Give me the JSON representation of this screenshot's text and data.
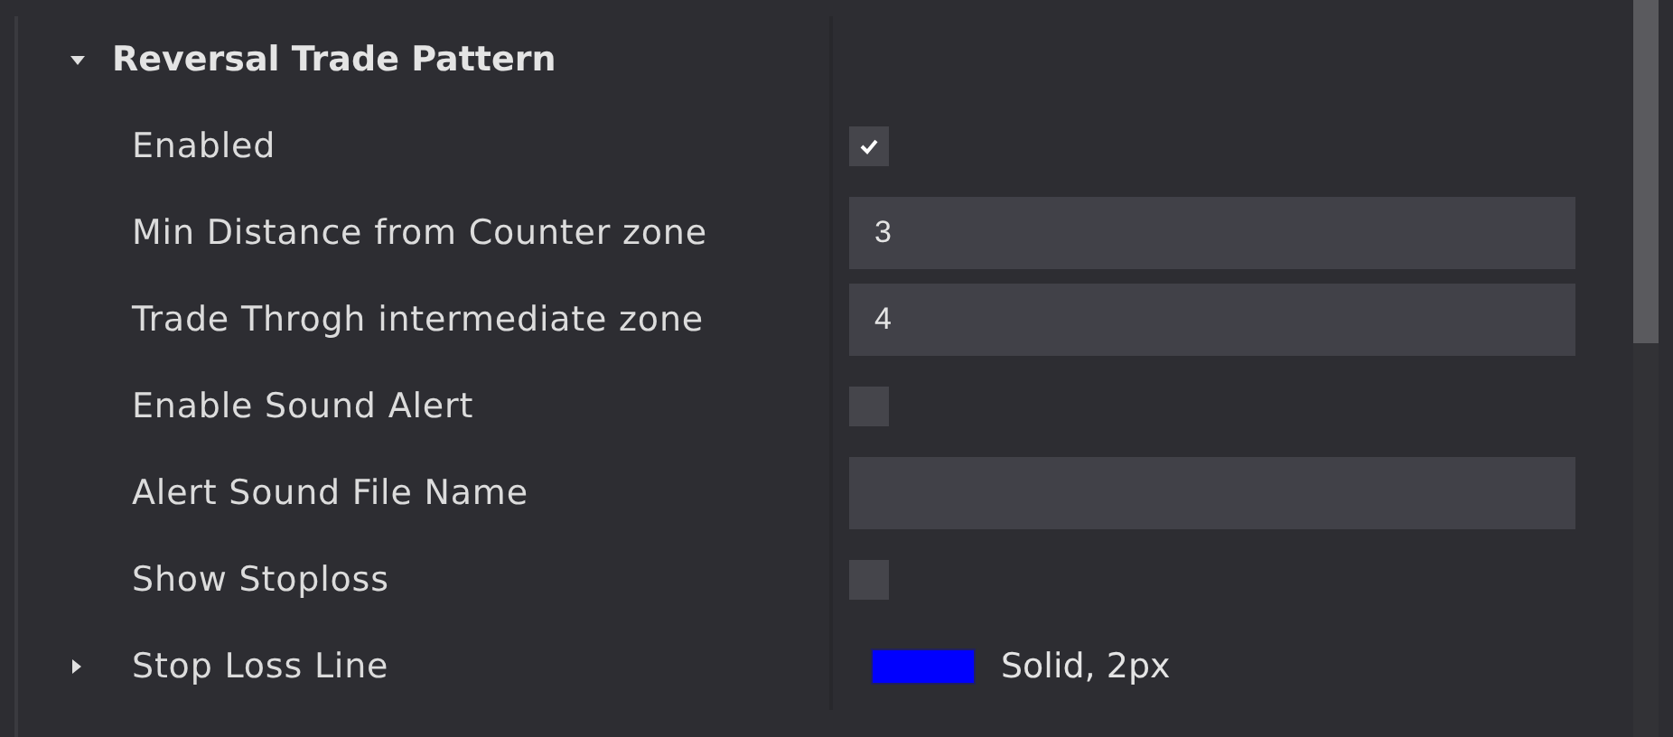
{
  "category": {
    "title": "Reversal Trade Pattern",
    "expanded": true
  },
  "properties": [
    {
      "label": "Enabled",
      "kind": "checkbox",
      "checked": true
    },
    {
      "label": "Min Distance from Counter zone",
      "kind": "text",
      "value": "3"
    },
    {
      "label": "Trade Throgh intermediate zone",
      "kind": "text",
      "value": "4"
    },
    {
      "label": "Enable Sound Alert",
      "kind": "checkbox",
      "checked": false
    },
    {
      "label": "Alert Sound File Name",
      "kind": "text"
    },
    {
      "label": "Show Stoploss",
      "kind": "checkbox",
      "checked": false
    },
    {
      "label": "Stop Loss Line",
      "kind": "stroke",
      "expanded": false,
      "color": "#0000ff",
      "value": "Solid, 2px"
    }
  ]
}
